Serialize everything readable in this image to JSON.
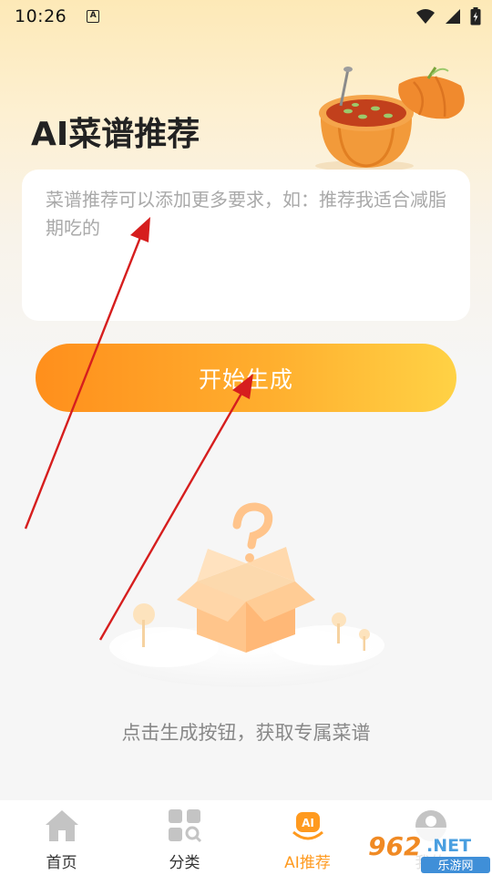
{
  "status_bar": {
    "time": "10:26",
    "notification_letter": "A"
  },
  "page": {
    "title": "AI菜谱推荐"
  },
  "prompt": {
    "placeholder": "菜谱推荐可以添加更多要求，如：推荐我适合减脂期吃的",
    "value": ""
  },
  "actions": {
    "generate_label": "开始生成"
  },
  "empty_state": {
    "message": "点击生成按钮，获取专属菜谱"
  },
  "tabs": [
    {
      "label": "首页",
      "icon": "home-icon",
      "active": false
    },
    {
      "label": "分类",
      "icon": "category-icon",
      "active": false
    },
    {
      "label": "AI推荐",
      "icon": "ai-icon",
      "active": true
    },
    {
      "label": "我的",
      "icon": "profile-icon",
      "active": false
    }
  ],
  "ai_badge_text": "AI",
  "watermark": {
    "number": "962",
    "suffix": ".NET",
    "sub": "乐游网"
  },
  "colors": {
    "accent": "#ff9a1f",
    "button_start": "#ff8f1c",
    "button_end": "#ffd245",
    "annotation_arrow": "#d61e1e"
  }
}
